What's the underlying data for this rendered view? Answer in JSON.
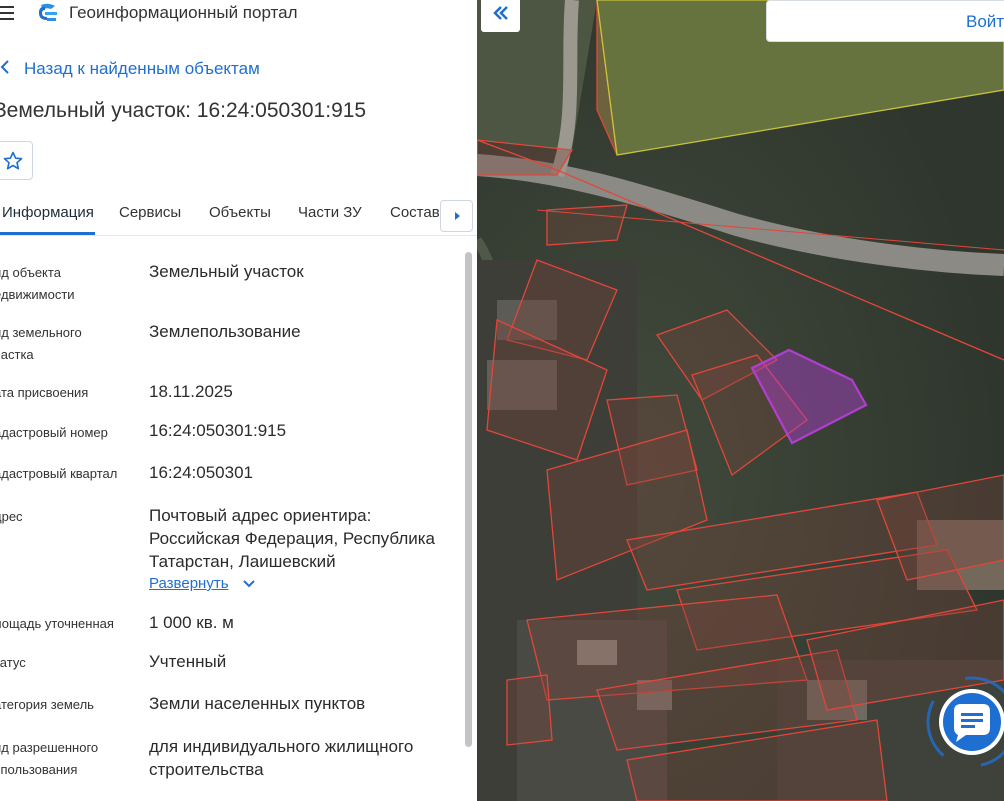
{
  "header": {
    "title": "Геоинформационный портал"
  },
  "back": {
    "label": "Назад к найденным объектам"
  },
  "object": {
    "title": "Земельный участок: 16:24:050301:915"
  },
  "tabs": [
    {
      "label": "Информация",
      "active": true
    },
    {
      "label": "Сервисы"
    },
    {
      "label": "Объекты"
    },
    {
      "label": "Части ЗУ"
    },
    {
      "label": "Состав"
    }
  ],
  "properties": [
    {
      "label": "ид объекта\nедвижимости",
      "value": "Земельный участок"
    },
    {
      "label": "ид земельного\nчастка",
      "value": "Землепользование"
    },
    {
      "label": "ата присвоения",
      "value": "18.11.2025"
    },
    {
      "label": "адастровый номер",
      "value": "16:24:050301:915"
    },
    {
      "label": "адастровый квартал",
      "value": "16:24:050301"
    },
    {
      "label": "дрес",
      "value": "Почтовый адрес ориентира:\nРоссийская Федерация, Республика\nТатарстан, Лаишевский"
    },
    {
      "label": "лощадь уточненная",
      "value": "1 000 кв. м"
    },
    {
      "label": "татус",
      "value": "Учтенный"
    },
    {
      "label": "атегория земель",
      "value": "Земли населенных пунктов"
    },
    {
      "label": "ид разрешенного\nспользования",
      "value": "для индивидуального жилищного\nстроительства"
    }
  ],
  "expand": {
    "label": "Развернуть"
  },
  "map": {
    "login_label": "Войт"
  },
  "colors": {
    "accent": "#1e6fd1",
    "parcel_border": "#e2463a",
    "selected_parcel": "#b03fd0",
    "zone_border": "#c9c53a"
  },
  "icons": {
    "menu": "menu-icon",
    "logo": "portal-logo-icon",
    "back": "chevron-left-icon",
    "favorite": "star-icon",
    "next": "caret-right-icon",
    "collapse": "double-chevron-left-icon",
    "chat": "chat-icon"
  }
}
